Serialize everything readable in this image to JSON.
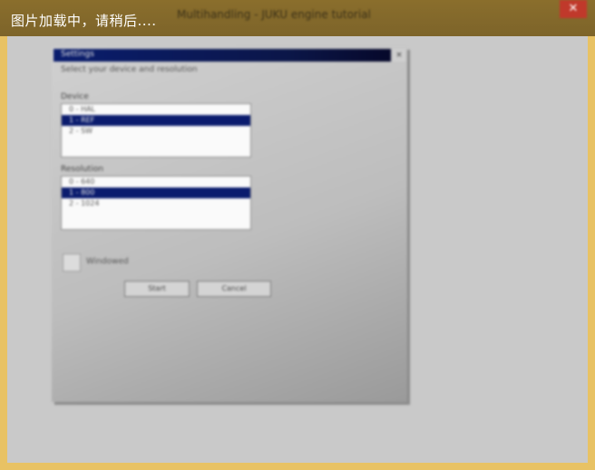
{
  "window": {
    "loading_text": "图片加载中，请稍后....",
    "title": "Multihandling - JUKU engine tutorial",
    "close_glyph": "✕"
  },
  "dialog": {
    "title": "Settings",
    "subtitle": "Select your device and resolution",
    "close_glyph": "×",
    "device_group": {
      "label": "Device",
      "items": [
        "0 - HAL",
        "1 - REF",
        "2 - SW"
      ],
      "selected_index": 1
    },
    "resolution_group": {
      "label": "Resolution",
      "items": [
        "0 - 640",
        "1 - 800",
        "2 - 1024"
      ],
      "selected_index": 1
    },
    "checkbox_label": "Windowed",
    "ok_label": "Start",
    "cancel_label": "Cancel"
  }
}
